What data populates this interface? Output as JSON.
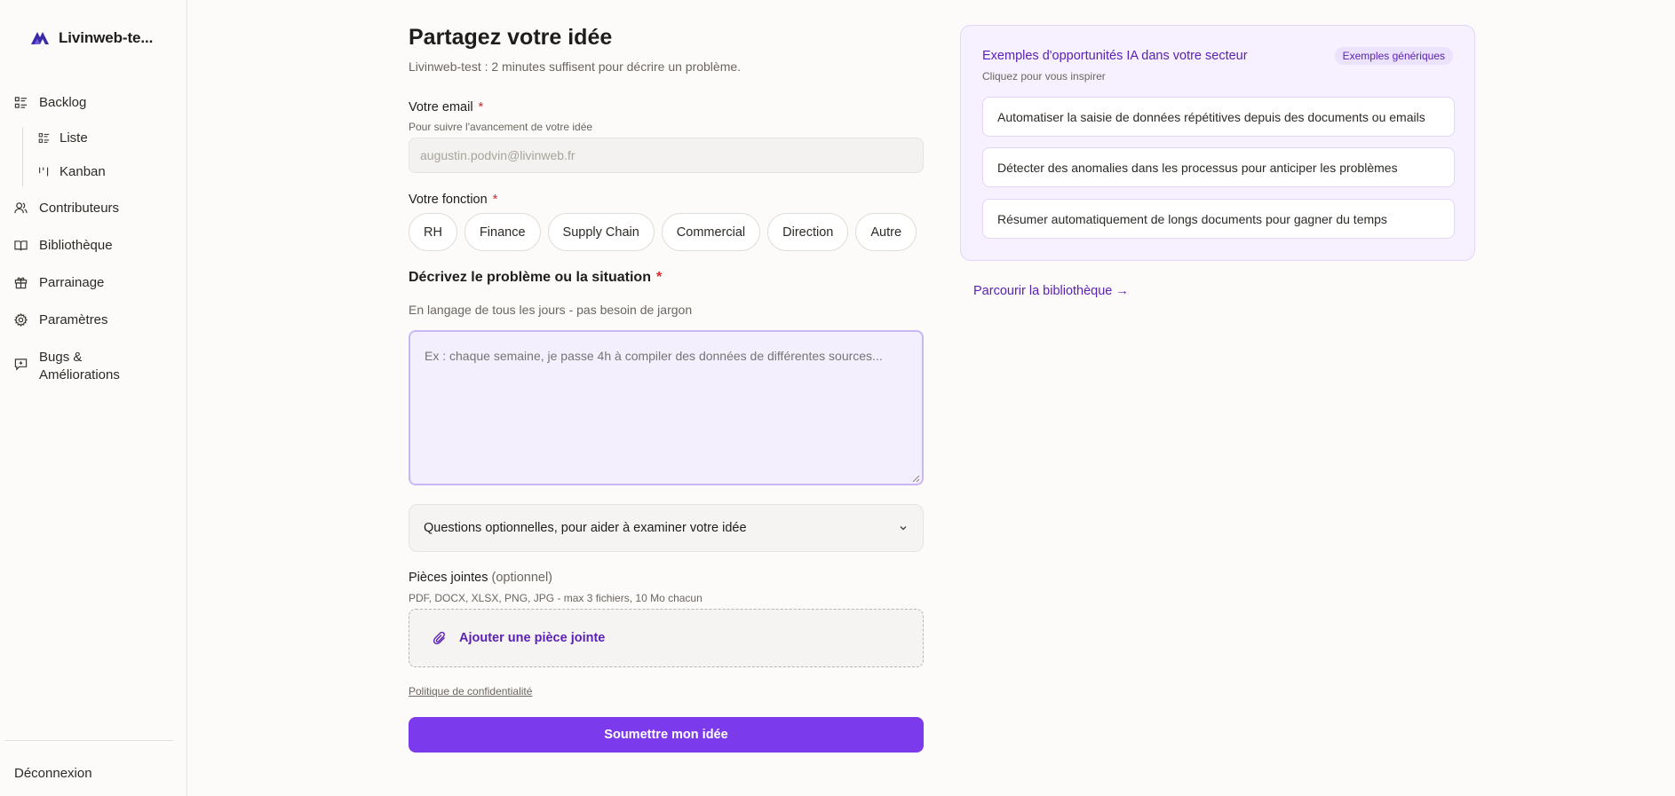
{
  "sidebar": {
    "brand": "Livinweb-te...",
    "items": [
      {
        "label": "Backlog",
        "icon": "list-icon"
      },
      {
        "label": "Liste",
        "icon": "list-icon"
      },
      {
        "label": "Kanban",
        "icon": "kanban-icon"
      },
      {
        "label": "Contributeurs",
        "icon": "users-icon"
      },
      {
        "label": "Bibliothèque",
        "icon": "book-icon"
      },
      {
        "label": "Parrainage",
        "icon": "gift-icon"
      },
      {
        "label": "Paramètres",
        "icon": "gear-icon"
      },
      {
        "label_line1": "Bugs &",
        "label_line2": "Améliorations",
        "icon": "feedback-icon"
      }
    ],
    "logout": "Déconnexion"
  },
  "form": {
    "title": "Partagez votre idée",
    "subtitle": "Livinweb-test : 2 minutes suffisent pour décrire un problème.",
    "email_label": "Votre email",
    "email_hint": "Pour suivre l'avancement de votre idée",
    "email_value": "augustin.podvin@livinweb.fr",
    "function_label": "Votre fonction",
    "required_mark": "*",
    "functions": [
      "RH",
      "Finance",
      "Supply Chain",
      "Commercial",
      "Direction",
      "Autre"
    ],
    "problem_label": "Décrivez le problème ou la situation",
    "problem_hint": "En langage de tous les jours - pas besoin de jargon",
    "problem_placeholder": "Ex : chaque semaine, je passe 4h à compiler des données de différentes sources...",
    "optional_questions": "Questions optionnelles, pour aider à examiner votre idée",
    "attachments_label": "Pièces jointes",
    "attachments_optional": "(optionnel)",
    "attachments_hint": "PDF, DOCX, XLSX, PNG, JPG - max 3 fichiers, 10 Mo chacun",
    "add_attachment": "Ajouter une pièce jointe",
    "privacy": "Politique de confidentialité",
    "submit": "Soumettre mon idée"
  },
  "panel": {
    "title": "Exemples d'opportunités IA dans votre secteur",
    "badge": "Exemples génériques",
    "subtitle": "Cliquez pour vous inspirer",
    "examples": [
      "Automatiser la saisie de données répétitives depuis des documents ou emails",
      "Détecter des anomalies dans les processus pour anticiper les problèmes",
      "Résumer automatiquement de longs documents pour gagner du temps"
    ],
    "browse": "Parcourir la bibliothèque →"
  },
  "colors": {
    "accent": "#7c3aed",
    "accent_text": "#5b21b6",
    "required": "#dc2626",
    "panel_bg": "#f6f0ff"
  }
}
